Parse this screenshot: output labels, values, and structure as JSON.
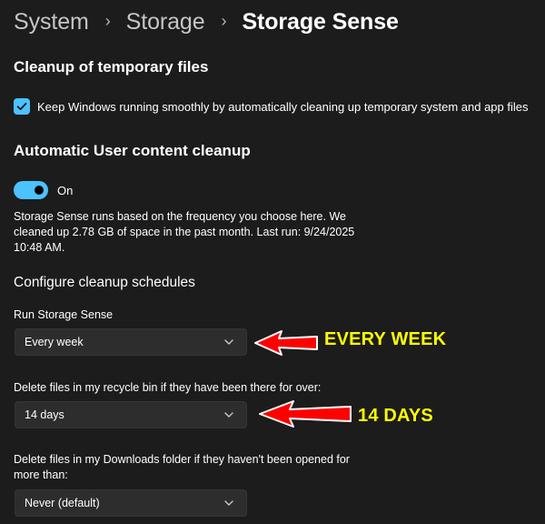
{
  "breadcrumb": {
    "items": [
      "System",
      "Storage"
    ],
    "current": "Storage Sense"
  },
  "temp_cleanup": {
    "title": "Cleanup of temporary files",
    "checkbox_label": "Keep Windows running smoothly by automatically cleaning up temporary system and app files",
    "checked": true
  },
  "user_cleanup": {
    "title": "Automatic User content cleanup",
    "toggle_label": "On",
    "toggle_on": true,
    "description": "Storage Sense runs based on the frequency you choose here. We cleaned up 2.78 GB of space in the past month. Last run: 9/24/2025 10:48 AM."
  },
  "schedules": {
    "title": "Configure cleanup schedules",
    "run_label": "Run Storage Sense",
    "run_value": "Every week",
    "recycle_label": "Delete files in my recycle bin if they have been there for over:",
    "recycle_value": "14 days",
    "downloads_label": "Delete files in my Downloads folder if they haven't been opened for more than:",
    "downloads_value": "Never (default)"
  },
  "annotations": {
    "run": "EVERY WEEK",
    "recycle": "14 DAYS"
  },
  "colors": {
    "background": "#1c1c1c",
    "accent": "#4cc2ff",
    "annotation_text": "#ffff00",
    "annotation_arrow": "#ff0000"
  },
  "icons": {
    "checkbox": "checkmark-icon",
    "dropdown": "chevron-down-icon",
    "annotation": "red-arrow-icon"
  }
}
